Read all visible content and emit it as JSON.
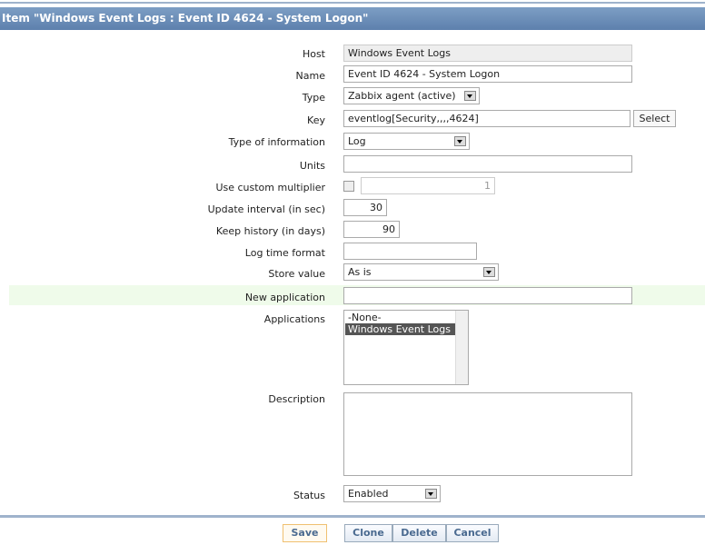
{
  "title": "Item \"Windows Event Logs : Event ID 4624 - System Logon\"",
  "fields": {
    "host": {
      "label": "Host",
      "value": "Windows Event Logs"
    },
    "name": {
      "label": "Name",
      "value": "Event ID 4624 - System Logon"
    },
    "type": {
      "label": "Type",
      "value": "Zabbix agent (active)"
    },
    "key": {
      "label": "Key",
      "value": "eventlog[Security,,,,4624]",
      "button": "Select"
    },
    "type_info": {
      "label": "Type of information",
      "value": "Log"
    },
    "units": {
      "label": "Units",
      "value": ""
    },
    "multiplier": {
      "label": "Use custom multiplier",
      "value": "1"
    },
    "interval": {
      "label": "Update interval (in sec)",
      "value": "30"
    },
    "history": {
      "label": "Keep history (in days)",
      "value": "90"
    },
    "log_time": {
      "label": "Log time format",
      "value": ""
    },
    "store": {
      "label": "Store value",
      "value": "As is"
    },
    "new_app": {
      "label": "New application",
      "value": ""
    },
    "applications": {
      "label": "Applications",
      "options": [
        "-None-",
        "Windows Event Logs"
      ]
    },
    "description": {
      "label": "Description",
      "value": ""
    },
    "status": {
      "label": "Status",
      "value": "Enabled"
    }
  },
  "buttons": {
    "save": "Save",
    "clone": "Clone",
    "delete": "Delete",
    "cancel": "Cancel"
  }
}
